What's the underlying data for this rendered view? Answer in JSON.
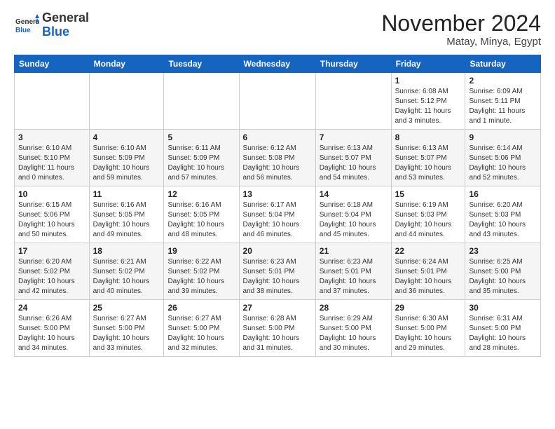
{
  "logo": {
    "general": "General",
    "blue": "Blue"
  },
  "title": "November 2024",
  "subtitle": "Matay, Minya, Egypt",
  "days_of_week": [
    "Sunday",
    "Monday",
    "Tuesday",
    "Wednesday",
    "Thursday",
    "Friday",
    "Saturday"
  ],
  "weeks": [
    [
      {
        "day": "",
        "info": ""
      },
      {
        "day": "",
        "info": ""
      },
      {
        "day": "",
        "info": ""
      },
      {
        "day": "",
        "info": ""
      },
      {
        "day": "",
        "info": ""
      },
      {
        "day": "1",
        "info": "Sunrise: 6:08 AM\nSunset: 5:12 PM\nDaylight: 11 hours\nand 3 minutes."
      },
      {
        "day": "2",
        "info": "Sunrise: 6:09 AM\nSunset: 5:11 PM\nDaylight: 11 hours\nand 1 minute."
      }
    ],
    [
      {
        "day": "3",
        "info": "Sunrise: 6:10 AM\nSunset: 5:10 PM\nDaylight: 11 hours\nand 0 minutes."
      },
      {
        "day": "4",
        "info": "Sunrise: 6:10 AM\nSunset: 5:09 PM\nDaylight: 10 hours\nand 59 minutes."
      },
      {
        "day": "5",
        "info": "Sunrise: 6:11 AM\nSunset: 5:09 PM\nDaylight: 10 hours\nand 57 minutes."
      },
      {
        "day": "6",
        "info": "Sunrise: 6:12 AM\nSunset: 5:08 PM\nDaylight: 10 hours\nand 56 minutes."
      },
      {
        "day": "7",
        "info": "Sunrise: 6:13 AM\nSunset: 5:07 PM\nDaylight: 10 hours\nand 54 minutes."
      },
      {
        "day": "8",
        "info": "Sunrise: 6:13 AM\nSunset: 5:07 PM\nDaylight: 10 hours\nand 53 minutes."
      },
      {
        "day": "9",
        "info": "Sunrise: 6:14 AM\nSunset: 5:06 PM\nDaylight: 10 hours\nand 52 minutes."
      }
    ],
    [
      {
        "day": "10",
        "info": "Sunrise: 6:15 AM\nSunset: 5:06 PM\nDaylight: 10 hours\nand 50 minutes."
      },
      {
        "day": "11",
        "info": "Sunrise: 6:16 AM\nSunset: 5:05 PM\nDaylight: 10 hours\nand 49 minutes."
      },
      {
        "day": "12",
        "info": "Sunrise: 6:16 AM\nSunset: 5:05 PM\nDaylight: 10 hours\nand 48 minutes."
      },
      {
        "day": "13",
        "info": "Sunrise: 6:17 AM\nSunset: 5:04 PM\nDaylight: 10 hours\nand 46 minutes."
      },
      {
        "day": "14",
        "info": "Sunrise: 6:18 AM\nSunset: 5:04 PM\nDaylight: 10 hours\nand 45 minutes."
      },
      {
        "day": "15",
        "info": "Sunrise: 6:19 AM\nSunset: 5:03 PM\nDaylight: 10 hours\nand 44 minutes."
      },
      {
        "day": "16",
        "info": "Sunrise: 6:20 AM\nSunset: 5:03 PM\nDaylight: 10 hours\nand 43 minutes."
      }
    ],
    [
      {
        "day": "17",
        "info": "Sunrise: 6:20 AM\nSunset: 5:02 PM\nDaylight: 10 hours\nand 42 minutes."
      },
      {
        "day": "18",
        "info": "Sunrise: 6:21 AM\nSunset: 5:02 PM\nDaylight: 10 hours\nand 40 minutes."
      },
      {
        "day": "19",
        "info": "Sunrise: 6:22 AM\nSunset: 5:02 PM\nDaylight: 10 hours\nand 39 minutes."
      },
      {
        "day": "20",
        "info": "Sunrise: 6:23 AM\nSunset: 5:01 PM\nDaylight: 10 hours\nand 38 minutes."
      },
      {
        "day": "21",
        "info": "Sunrise: 6:23 AM\nSunset: 5:01 PM\nDaylight: 10 hours\nand 37 minutes."
      },
      {
        "day": "22",
        "info": "Sunrise: 6:24 AM\nSunset: 5:01 PM\nDaylight: 10 hours\nand 36 minutes."
      },
      {
        "day": "23",
        "info": "Sunrise: 6:25 AM\nSunset: 5:00 PM\nDaylight: 10 hours\nand 35 minutes."
      }
    ],
    [
      {
        "day": "24",
        "info": "Sunrise: 6:26 AM\nSunset: 5:00 PM\nDaylight: 10 hours\nand 34 minutes."
      },
      {
        "day": "25",
        "info": "Sunrise: 6:27 AM\nSunset: 5:00 PM\nDaylight: 10 hours\nand 33 minutes."
      },
      {
        "day": "26",
        "info": "Sunrise: 6:27 AM\nSunset: 5:00 PM\nDaylight: 10 hours\nand 32 minutes."
      },
      {
        "day": "27",
        "info": "Sunrise: 6:28 AM\nSunset: 5:00 PM\nDaylight: 10 hours\nand 31 minutes."
      },
      {
        "day": "28",
        "info": "Sunrise: 6:29 AM\nSunset: 5:00 PM\nDaylight: 10 hours\nand 30 minutes."
      },
      {
        "day": "29",
        "info": "Sunrise: 6:30 AM\nSunset: 5:00 PM\nDaylight: 10 hours\nand 29 minutes."
      },
      {
        "day": "30",
        "info": "Sunrise: 6:31 AM\nSunset: 5:00 PM\nDaylight: 10 hours\nand 28 minutes."
      }
    ]
  ]
}
